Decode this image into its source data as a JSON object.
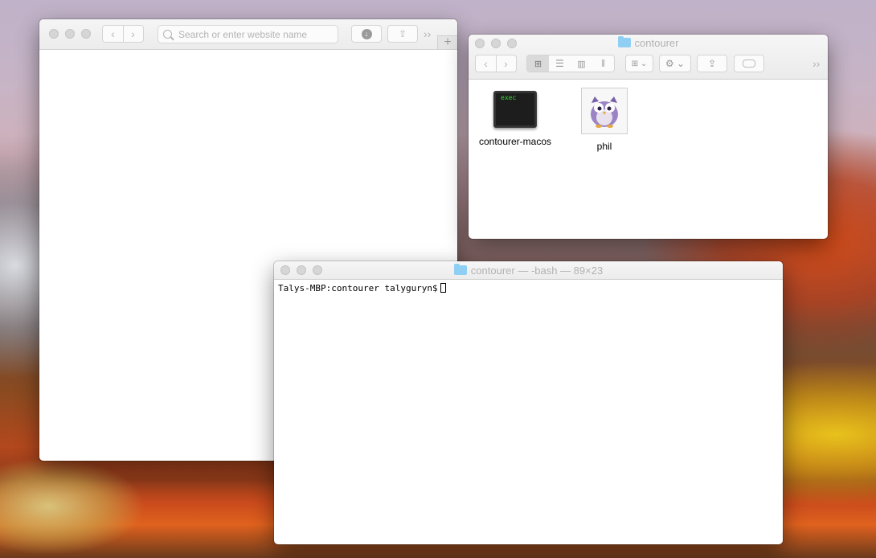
{
  "safari": {
    "back_icon": "chevron-left-icon",
    "forward_icon": "chevron-right-icon",
    "search_placeholder": "Search or enter website name",
    "more_label": "››",
    "new_tab_label": "+"
  },
  "finder": {
    "title": "contourer",
    "more_label": "››",
    "files": [
      {
        "name": "contourer-macos",
        "icon_text": "exec"
      },
      {
        "name": "phil"
      }
    ]
  },
  "terminal": {
    "title": "contourer — -bash — 89×23",
    "prompt": "Talys-MBP:contourer talyguryn$"
  }
}
